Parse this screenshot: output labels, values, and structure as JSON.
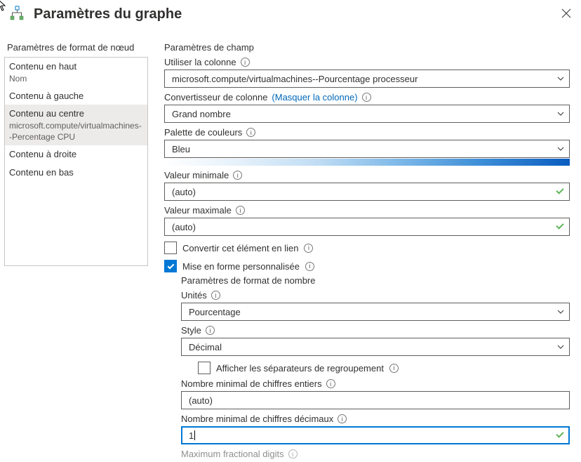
{
  "header": {
    "title": "Paramètres du graphe"
  },
  "sidebar": {
    "title": "Paramètres de format de nœud",
    "items": [
      {
        "label": "Contenu en haut",
        "sub": "Nom"
      },
      {
        "label": "Contenu à gauche",
        "sub": ""
      },
      {
        "label": "Contenu au centre",
        "sub": "microsoft.compute/virtualmachines--Percentage CPU"
      },
      {
        "label": "Contenu à droite",
        "sub": ""
      },
      {
        "label": "Contenu en bas",
        "sub": ""
      }
    ],
    "selected_index": 2
  },
  "main": {
    "section_title": "Paramètres de champ",
    "use_column": {
      "label": "Utiliser la colonne",
      "value": "microsoft.compute/virtualmachines--Pourcentage processeur"
    },
    "converter": {
      "label": "Convertisseur de colonne",
      "hide_link": "(Masquer la colonne)",
      "value": "Grand nombre"
    },
    "palette": {
      "label": "Palette de couleurs",
      "value": "Bleu"
    },
    "min": {
      "label": "Valeur minimale",
      "value": "(auto)"
    },
    "max": {
      "label": "Valeur maximale",
      "value": "(auto)"
    },
    "make_link": {
      "label": "Convertir cet élément en lien",
      "checked": false
    },
    "custom_fmt": {
      "label": "Mise en forme personnalisée",
      "checked": true
    },
    "numfmt": {
      "title": "Paramètres de format de nombre",
      "units": {
        "label": "Unités",
        "value": "Pourcentage"
      },
      "style": {
        "label": "Style",
        "value": "Décimal"
      },
      "group_sep": {
        "label": "Afficher les séparateurs de regroupement",
        "checked": false
      },
      "min_int": {
        "label": "Nombre minimal de chiffres entiers",
        "value": "(auto)"
      },
      "min_frac": {
        "label": "Nombre minimal de chiffres décimaux",
        "value": "1"
      },
      "max_frac": {
        "label": "Maximum fractional digits"
      }
    }
  }
}
